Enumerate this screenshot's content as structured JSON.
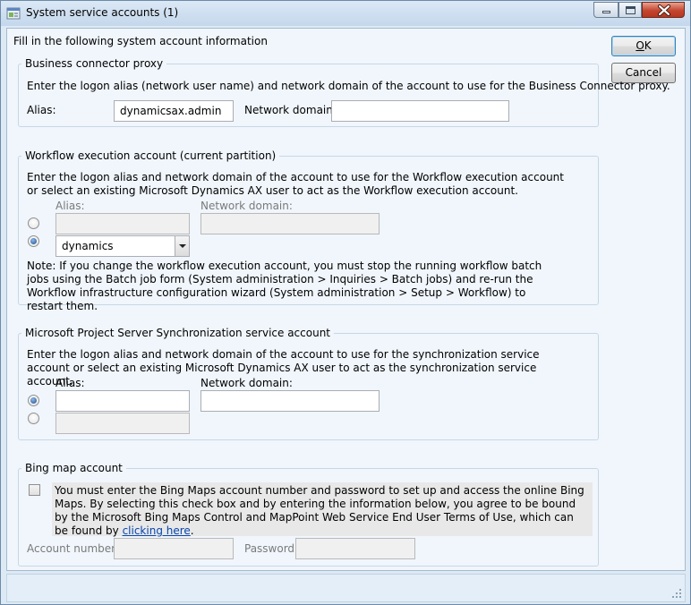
{
  "window": {
    "title": "System service accounts (1)",
    "instruction": "Fill in the following system account information",
    "ok_label": "OK",
    "ok_prefix": "",
    "ok_mnemonic": "O",
    "ok_rest": "K",
    "cancel_label": "Cancel"
  },
  "business_connector": {
    "title": "Business connector proxy",
    "description": "Enter the logon alias (network user name) and network domain of the account to use for the Business Connector proxy.",
    "alias_label": "Alias:",
    "alias_value": "dynamicsax.admin",
    "domain_label": "Network domain:",
    "domain_value": ""
  },
  "workflow": {
    "title": "Workflow execution account (current partition)",
    "description": "Enter the logon alias and network domain of the account to use for the Workflow execution account or select an existing Microsoft Dynamics AX user to act as the Workflow execution account.",
    "alias_label": "Alias:",
    "domain_label": "Network domain:",
    "alias_value": "",
    "domain_value": "",
    "user_value": "dynamics",
    "selected_option": "user",
    "note": "Note: If you change the workflow execution account, you must stop the running workflow batch jobs using the Batch job form (System administration > Inquiries > Batch jobs) and re-run the Workflow infrastructure configuration wizard (System administration > Setup > Workflow) to restart them."
  },
  "project_server": {
    "title": "Microsoft Project Server Synchronization service account",
    "description": "Enter the logon alias and network domain of the account to use for the synchronization service account or select an existing Microsoft Dynamics AX user to act as the  synchronization service account.",
    "alias_label": "Alias:",
    "domain_label": "Network domain:",
    "alias_value": "",
    "domain_value": "",
    "user_value": "",
    "selected_option": "alias"
  },
  "bing": {
    "title": "Bing map account",
    "terms_text": "You must enter the Bing Maps account number and password to set up and access the online Bing Maps. By selecting this check box and by entering the information below, you agree to be bound by the Microsoft Bing Maps Control and MapPoint Web Service End User Terms of Use, which can be found by ",
    "link_text": "clicking here",
    "terms_end": ".",
    "checked": false,
    "account_label": "Account number:",
    "account_value": "",
    "password_label": "Password:",
    "password_value": ""
  },
  "icons": {
    "app": "app-icon",
    "minimize": "minimize-icon",
    "maximize": "maximize-icon",
    "close": "close-icon",
    "dropdown": "chevron-down-icon",
    "grip": "resize-grip-icon"
  },
  "colors": {
    "accent": "#3c7fb1",
    "close": "#c4452f",
    "link": "#0645ad",
    "content_bg": "#f0f6fc"
  }
}
